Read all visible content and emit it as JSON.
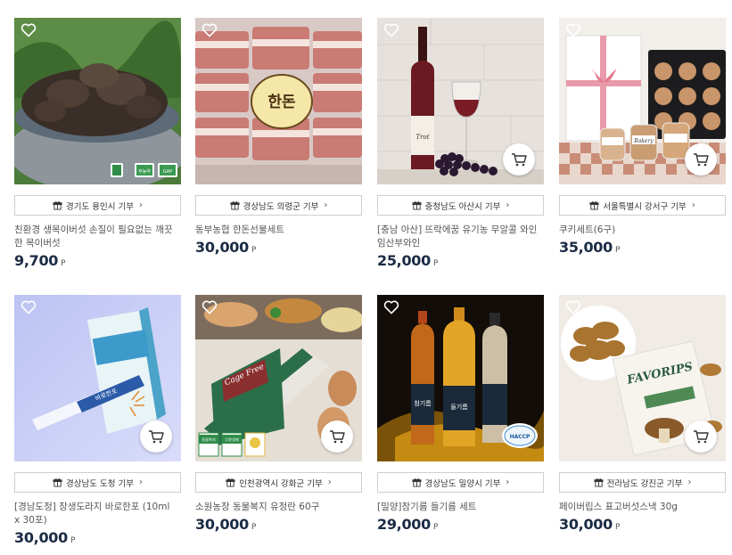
{
  "products": [
    {
      "region": "경기도 용인시 기부",
      "name": "친환경 생목이버섯 손질이 필요없는 깨끗한 목이버섯",
      "price": "9,700",
      "currency": "P",
      "has_cart": false,
      "badges": [
        "무농약",
        "GAP"
      ]
    },
    {
      "region": "경상남도 의령군 기부",
      "name": "동부농협 한돈선물세트",
      "price": "30,000",
      "currency": "P",
      "has_cart": false,
      "label_text": "한돈"
    },
    {
      "region": "충청남도 아산시 기부",
      "name": "[충남 아산] 뜨락에꿈 유기농 무알콜 와인 임산부와인",
      "price": "25,000",
      "currency": "P",
      "has_cart": true,
      "label_text": "Trot"
    },
    {
      "region": "서울특별시 강서구 기부",
      "name": "쿠키세트(6구)",
      "price": "35,000",
      "currency": "P",
      "has_cart": true,
      "label_text": "Bakery"
    },
    {
      "region": "경상남도 도청 기부",
      "name": "[경남도정] 장생도라지 바로한포 (10ml x 30포)",
      "price": "30,000",
      "currency": "P",
      "has_cart": true,
      "label_text": "바로한포"
    },
    {
      "region": "인천광역시 강화군 기부",
      "name": "소원농장 동물복지 유정란 60구",
      "price": "30,000",
      "currency": "P",
      "has_cart": true,
      "label_text": "Cage Free",
      "badges": [
        "동물복지",
        "무항생제"
      ]
    },
    {
      "region": "경상남도 밀양시 기부",
      "name": "[밀양]참기름 들기름 세트",
      "price": "29,000",
      "currency": "P",
      "has_cart": false,
      "label_text": "참기름",
      "label_text_2": "들기름",
      "badges": [
        "HACCP"
      ]
    },
    {
      "region": "전라남도 강진군 기부",
      "name": "페이버립스 표고버섯스낵 30g",
      "price": "30,000",
      "currency": "P",
      "has_cart": true,
      "label_text": "FAVORIPS"
    }
  ]
}
